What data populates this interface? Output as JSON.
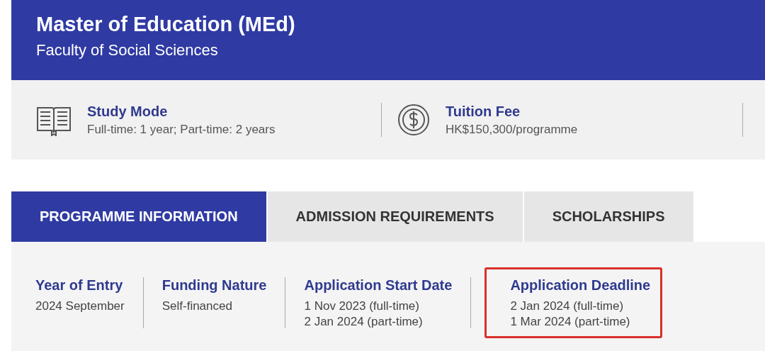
{
  "header": {
    "title": "Master of Education (MEd)",
    "subtitle": "Faculty of Social Sciences"
  },
  "highlights": [
    {
      "kind": "book",
      "label": "Study Mode",
      "value": "Full-time: 1 year; Part-time: 2 years"
    },
    {
      "kind": "coin",
      "label": "Tuition Fee",
      "value": "HK$150,300/programme"
    }
  ],
  "tabs": [
    {
      "label": "PROGRAMME INFORMATION",
      "selected": true
    },
    {
      "label": "ADMISSION REQUIREMENTS",
      "selected": false
    },
    {
      "label": "SCHOLARSHIPS",
      "selected": false
    }
  ],
  "facts": [
    {
      "label": "Year of Entry",
      "lines": [
        "2024 September"
      ],
      "highlighted": false
    },
    {
      "label": "Funding Nature",
      "lines": [
        "Self-financed"
      ],
      "highlighted": false
    },
    {
      "label": "Application Start Date",
      "lines": [
        "1 Nov 2023 (full-time)",
        "2 Jan 2024 (part-time)"
      ],
      "highlighted": false
    },
    {
      "label": "Application Deadline",
      "lines": [
        "2 Jan 2024 (full-time)",
        "1 Mar 2024 (part-time)"
      ],
      "highlighted": true
    }
  ]
}
